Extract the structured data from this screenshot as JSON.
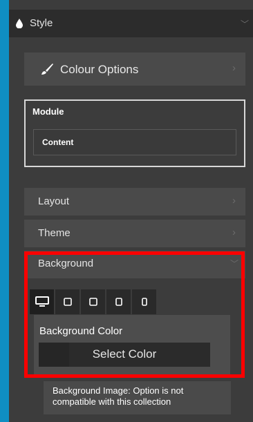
{
  "style_section": {
    "label": "Style",
    "chevron": "﹀"
  },
  "colour_options": {
    "label": "Colour Options",
    "chevron": "›"
  },
  "module": {
    "title": "Module",
    "field_value": "Content"
  },
  "layout": {
    "label": "Layout",
    "chevron": "›"
  },
  "theme": {
    "label": "Theme",
    "chevron": "›"
  },
  "background": {
    "label": "Background",
    "chevron": "﹀",
    "devices": [
      {
        "name": "desktop",
        "active": true
      },
      {
        "name": "laptop",
        "active": false
      },
      {
        "name": "tablet",
        "active": false
      },
      {
        "name": "tablet-small",
        "active": false
      },
      {
        "name": "mobile",
        "active": false
      }
    ],
    "color_label": "Background Color",
    "select_label": "Select Color",
    "image_note": "Background Image: Option is not compatible with this collection"
  },
  "colors": {
    "accent_blue": "#0f8ec2",
    "highlight_red": "#ff0000",
    "panel_bg": "#3c3c3c"
  }
}
